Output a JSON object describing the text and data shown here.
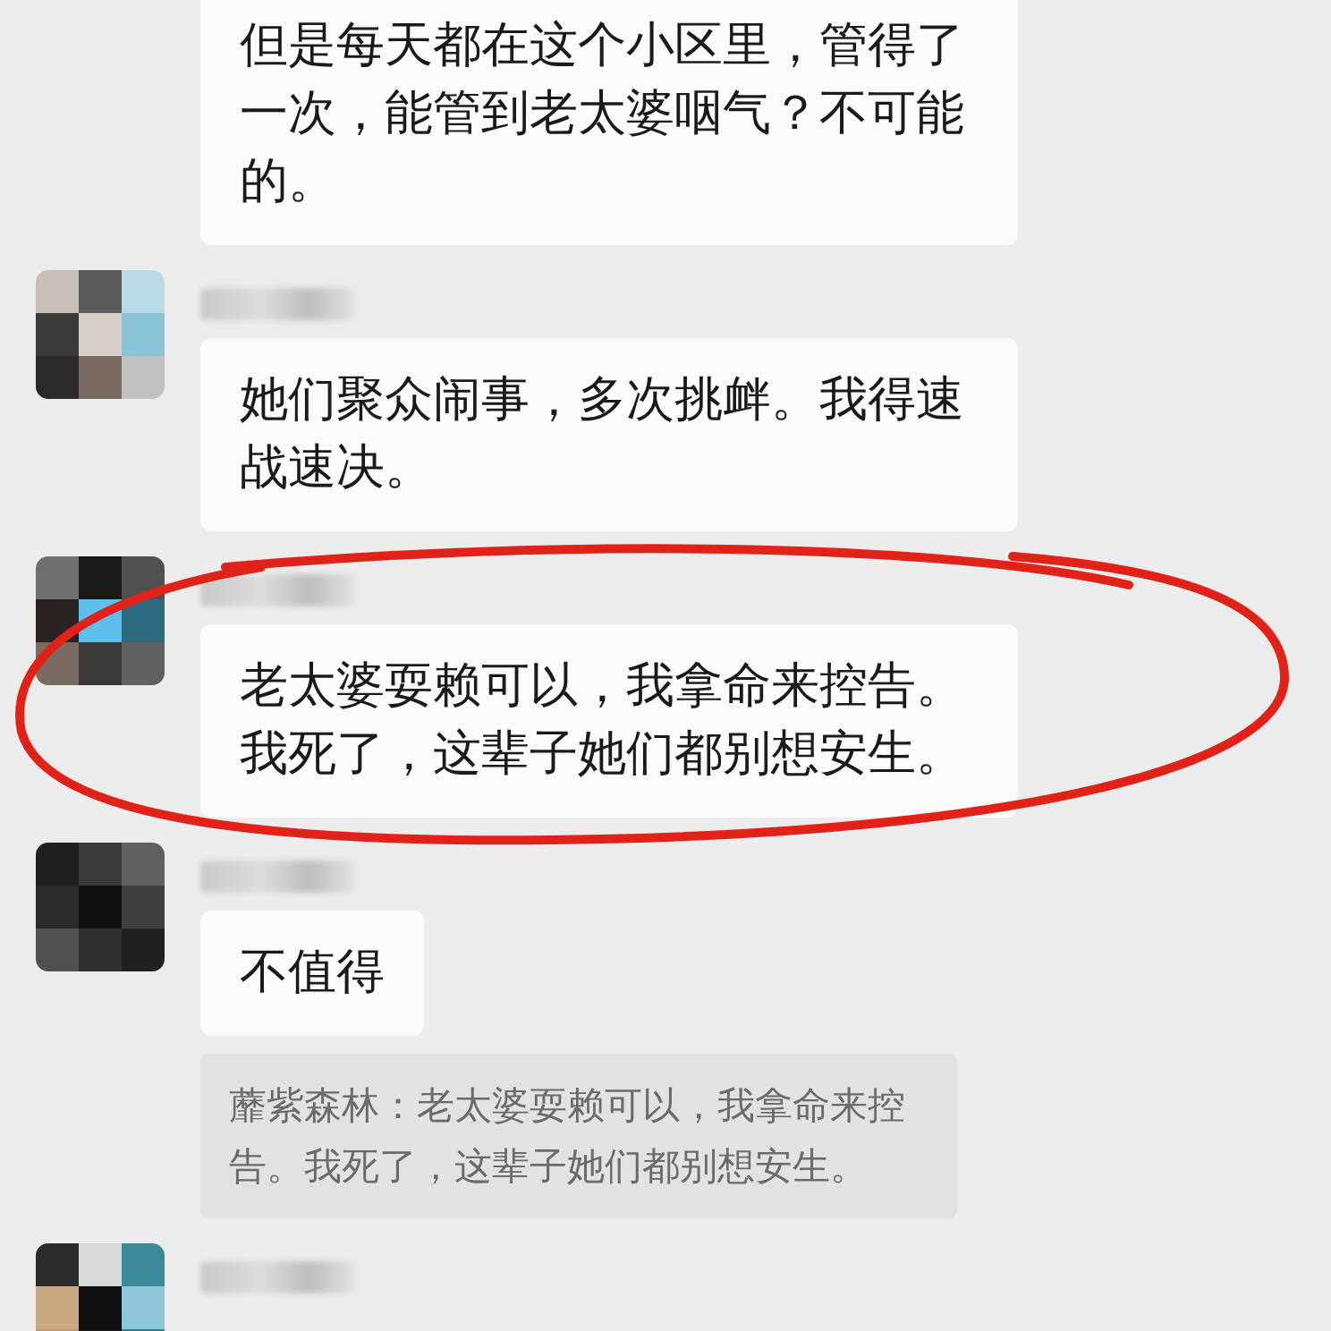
{
  "messages": [
    {
      "kind": "continued",
      "circled": false,
      "bubbles": [
        {
          "kind": "text",
          "text": "但是每天都在这个小区里，管得了一次，能管到老太婆咽气？不可能的。"
        }
      ]
    },
    {
      "kind": "member",
      "circled": false,
      "bubbles": [
        {
          "kind": "text",
          "text": "她们聚众闹事，多次挑衅。我得速战速决。"
        }
      ]
    },
    {
      "kind": "member",
      "circled": true,
      "bubbles": [
        {
          "kind": "text",
          "text": "老太婆耍赖可以，我拿命来控告。我死了，这辈子她们都别想安生。"
        }
      ]
    },
    {
      "kind": "member",
      "circled": false,
      "bubbles": [
        {
          "kind": "text",
          "text": "不值得"
        },
        {
          "kind": "quote",
          "text": "蘼紫森林：老太婆耍赖可以，我拿命来控告。我死了，这辈子她们都别想安生。"
        }
      ]
    },
    {
      "kind": "member",
      "circled": false
    }
  ]
}
